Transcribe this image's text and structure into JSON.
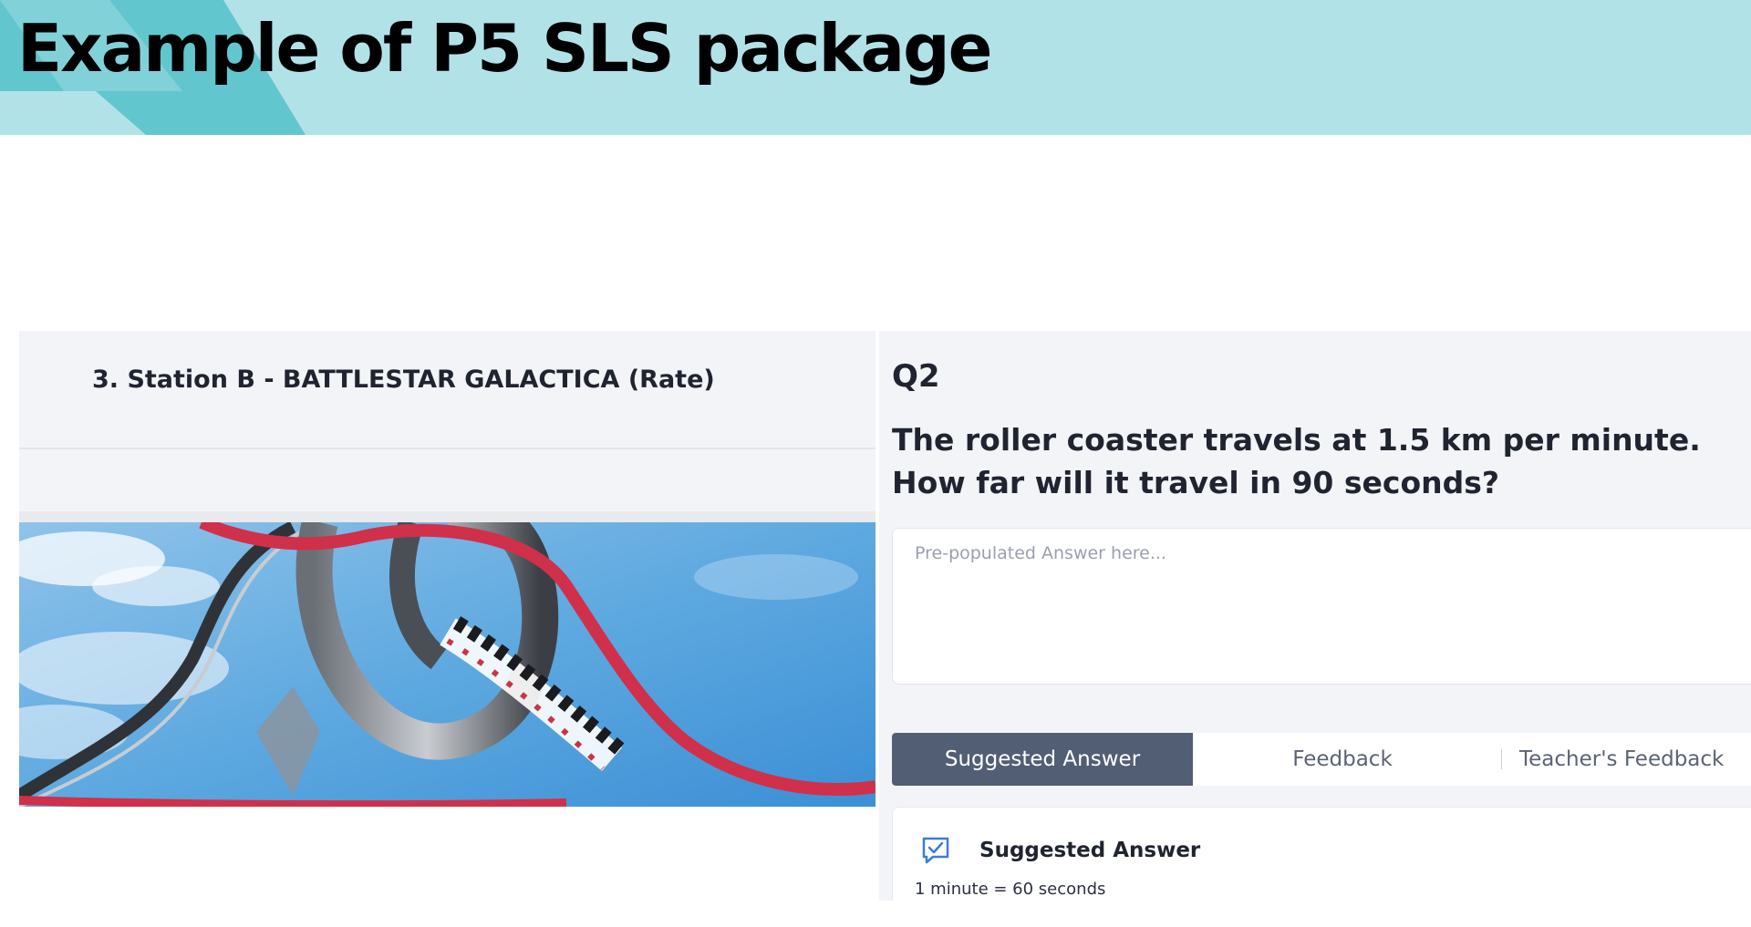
{
  "slide": {
    "title": "Example of P5 SLS package"
  },
  "left_panel": {
    "station_title": "3. Station B - BATTLESTAR GALACTICA (Rate)"
  },
  "question": {
    "number": "Q2",
    "lines": [
      "The roller coaster travels at 1.5 km per minute.",
      "How far will it travel in 90 seconds?"
    ],
    "answer_placeholder": "Pre-populated Answer here..."
  },
  "tabs": [
    {
      "label": "Suggested Answer",
      "active": true
    },
    {
      "label": "Feedback",
      "active": false
    },
    {
      "label": "Teacher's Feedback",
      "active": false
    }
  ],
  "suggested_answer": {
    "heading": "Suggested Answer",
    "body": "1 minute = 60 seconds",
    "icon": "chat-check-icon"
  },
  "colors": {
    "header_band": "#b1e2e8",
    "header_accent": "#62c6cf",
    "panel_background": "#f3f4f7",
    "active_tab": "#525e73",
    "icon_blue": "#3b7dd8"
  }
}
